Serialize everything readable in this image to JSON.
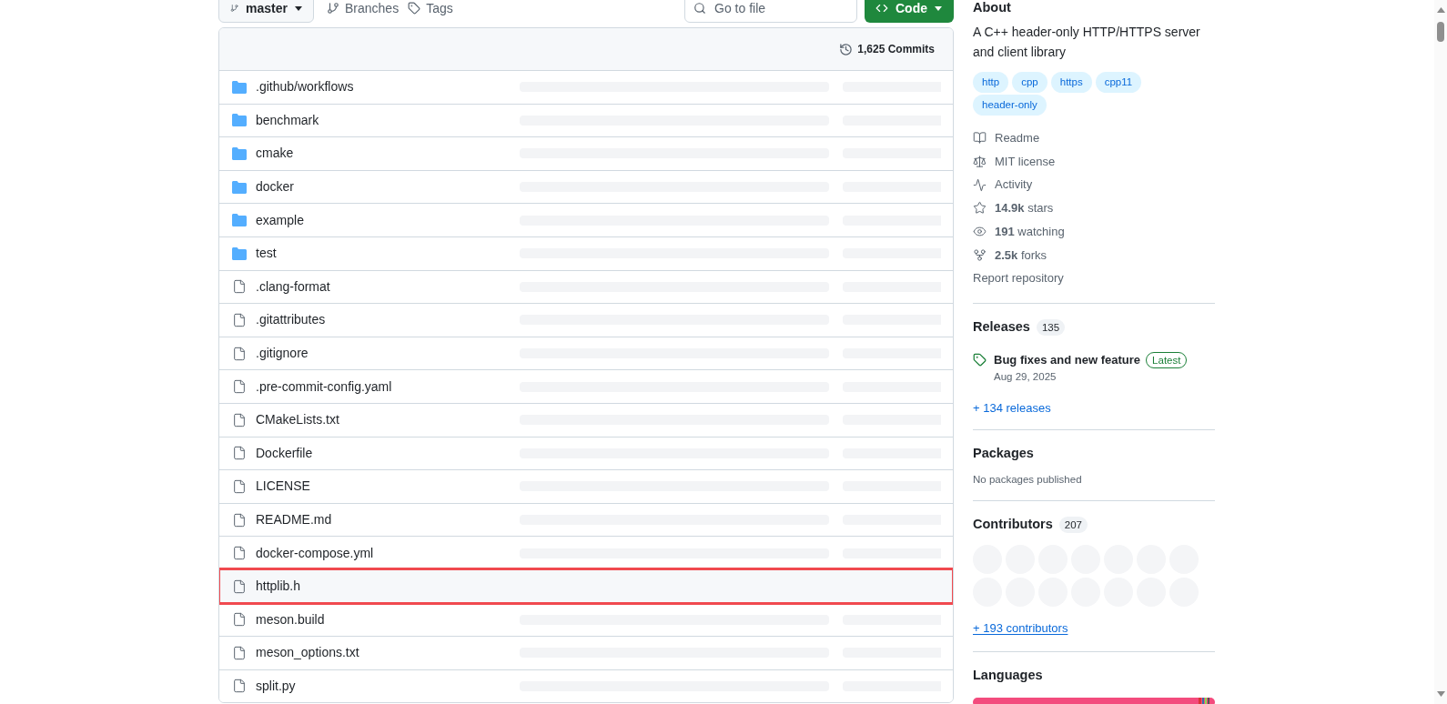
{
  "toolbar": {
    "branch": "master",
    "branches": "Branches",
    "tags": "Tags",
    "search": {
      "placeholder": "Go to file"
    },
    "code_button": "Code"
  },
  "file_table": {
    "commits": "1,625 Commits",
    "rows": [
      {
        "name": ".github/workflows",
        "kind": "folder",
        "highlighted": false
      },
      {
        "name": "benchmark",
        "kind": "folder",
        "highlighted": false
      },
      {
        "name": "cmake",
        "kind": "folder",
        "highlighted": false
      },
      {
        "name": "docker",
        "kind": "folder",
        "highlighted": false
      },
      {
        "name": "example",
        "kind": "folder",
        "highlighted": false
      },
      {
        "name": "test",
        "kind": "folder",
        "highlighted": false
      },
      {
        "name": ".clang-format",
        "kind": "file",
        "highlighted": false
      },
      {
        "name": ".gitattributes",
        "kind": "file",
        "highlighted": false
      },
      {
        "name": ".gitignore",
        "kind": "file",
        "highlighted": false
      },
      {
        "name": ".pre-commit-config.yaml",
        "kind": "file",
        "highlighted": false
      },
      {
        "name": "CMakeLists.txt",
        "kind": "file",
        "highlighted": false
      },
      {
        "name": "Dockerfile",
        "kind": "file",
        "highlighted": false
      },
      {
        "name": "LICENSE",
        "kind": "file",
        "highlighted": false
      },
      {
        "name": "README.md",
        "kind": "file",
        "highlighted": false
      },
      {
        "name": "docker-compose.yml",
        "kind": "file",
        "highlighted": false
      },
      {
        "name": "httplib.h",
        "kind": "file",
        "highlighted": true
      },
      {
        "name": "meson.build",
        "kind": "file",
        "highlighted": false
      },
      {
        "name": "meson_options.txt",
        "kind": "file",
        "highlighted": false
      },
      {
        "name": "split.py",
        "kind": "file",
        "highlighted": false
      }
    ]
  },
  "about": {
    "title": "About",
    "description": "A C++ header-only HTTP/HTTPS server and client library",
    "topics": [
      "http",
      "cpp",
      "https",
      "cpp11",
      "header-only"
    ],
    "links": [
      {
        "kind": "readme",
        "label": "Readme"
      },
      {
        "kind": "license",
        "label": "MIT license"
      },
      {
        "kind": "activity",
        "label": "Activity"
      },
      {
        "kind": "stars",
        "label": "**14.9k** stars"
      },
      {
        "kind": "watching",
        "label": "**191** watching"
      },
      {
        "kind": "forks",
        "label": "**2.5k** forks"
      },
      {
        "kind": "report",
        "label": "Report repository"
      }
    ]
  },
  "releases": {
    "title": "Releases",
    "count": "135",
    "latest": {
      "name": "Bug fixes and new feature",
      "badge": "Latest",
      "date": "Aug 29, 2025"
    },
    "more": "+ 134 releases"
  },
  "packages": {
    "title": "Packages",
    "note": "No packages published"
  },
  "contributors": {
    "title": "Contributors",
    "count": "207",
    "avatars": [
      {
        "kind": "loading"
      },
      {
        "kind": "loading"
      },
      {
        "kind": "loading"
      },
      {
        "kind": "loading"
      },
      {
        "kind": "loading"
      },
      {
        "kind": "loading"
      },
      {
        "kind": "loading"
      },
      {
        "kind": "loading"
      },
      {
        "kind": "loading"
      },
      {
        "kind": "loading"
      },
      {
        "kind": "loading"
      },
      {
        "kind": "loading"
      },
      {
        "kind": "loading"
      },
      {
        "kind": "loading"
      }
    ],
    "more": "+ 193 contributors"
  },
  "languages": {
    "title": "Languages"
  }
}
